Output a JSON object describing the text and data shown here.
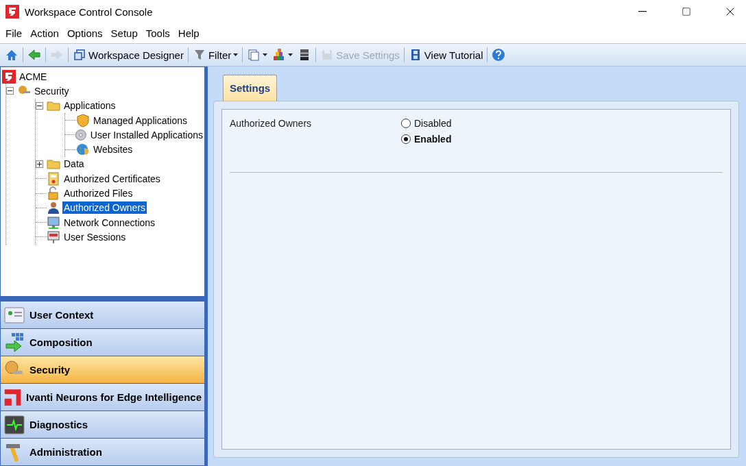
{
  "window": {
    "title": "Workspace Control Console"
  },
  "menu": [
    "File",
    "Action",
    "Options",
    "Setup",
    "Tools",
    "Help"
  ],
  "toolbar": [
    {
      "kind": "button",
      "disabled": false,
      "dropdown": false
    },
    {
      "kind": "separator"
    },
    {
      "kind": "button",
      "disabled": false,
      "dropdown": false
    },
    {
      "kind": "separator"
    },
    {
      "kind": "button",
      "disabled": true,
      "dropdown": false
    },
    {
      "kind": "separator"
    },
    {
      "kind": "button",
      "label": "Workspace Designer",
      "disabled": false,
      "dropdown": false
    },
    {
      "kind": "separator"
    },
    {
      "kind": "button",
      "label": "Filter",
      "disabled": false,
      "dropdown": true
    },
    {
      "kind": "separator"
    },
    {
      "kind": "button",
      "disabled": false,
      "dropdown": true
    },
    {
      "kind": "button",
      "disabled": false,
      "dropdown": true
    },
    {
      "kind": "button",
      "disabled": false,
      "dropdown": false
    },
    {
      "kind": "separator"
    },
    {
      "kind": "button",
      "label": "Save Settings",
      "disabled": true,
      "dropdown": false
    },
    {
      "kind": "separator"
    },
    {
      "kind": "button",
      "label": "View Tutorial",
      "disabled": false,
      "dropdown": false
    },
    {
      "kind": "separator"
    },
    {
      "kind": "button",
      "disabled": false,
      "dropdown": false
    }
  ],
  "tree": {
    "label": "ACME",
    "selected": false,
    "children": [
      {
        "label": "Security",
        "selected": false,
        "expanded": true,
        "children": [
          {
            "label": "Applications",
            "selected": false,
            "expanded": true,
            "children": [
              {
                "label": "Managed Applications",
                "selected": false
              },
              {
                "label": "User Installed Applications",
                "selected": false
              },
              {
                "label": "Websites",
                "selected": false
              }
            ]
          },
          {
            "label": "Data",
            "selected": false,
            "expanded": false
          },
          {
            "label": "Authorized Certificates",
            "selected": false
          },
          {
            "label": "Authorized Files",
            "selected": false
          },
          {
            "label": "Authorized Owners",
            "selected": true
          },
          {
            "label": "Network Connections",
            "selected": false
          },
          {
            "label": "User Sessions",
            "selected": false
          }
        ]
      }
    ]
  },
  "navigation": [
    {
      "label": "User Context",
      "selected": false
    },
    {
      "label": "Composition",
      "selected": false
    },
    {
      "label": "Security",
      "selected": true
    },
    {
      "label": "Ivanti Neurons for Edge Intelligence",
      "selected": false
    },
    {
      "label": "Diagnostics",
      "selected": false
    },
    {
      "label": "Administration",
      "selected": false
    }
  ],
  "tabs": [
    {
      "label": "Settings",
      "selected": true
    }
  ],
  "setting": {
    "label": "Authorized Owners",
    "options": [
      {
        "label": "Disabled",
        "selected": false
      },
      {
        "label": "Enabled",
        "selected": true
      }
    ]
  }
}
